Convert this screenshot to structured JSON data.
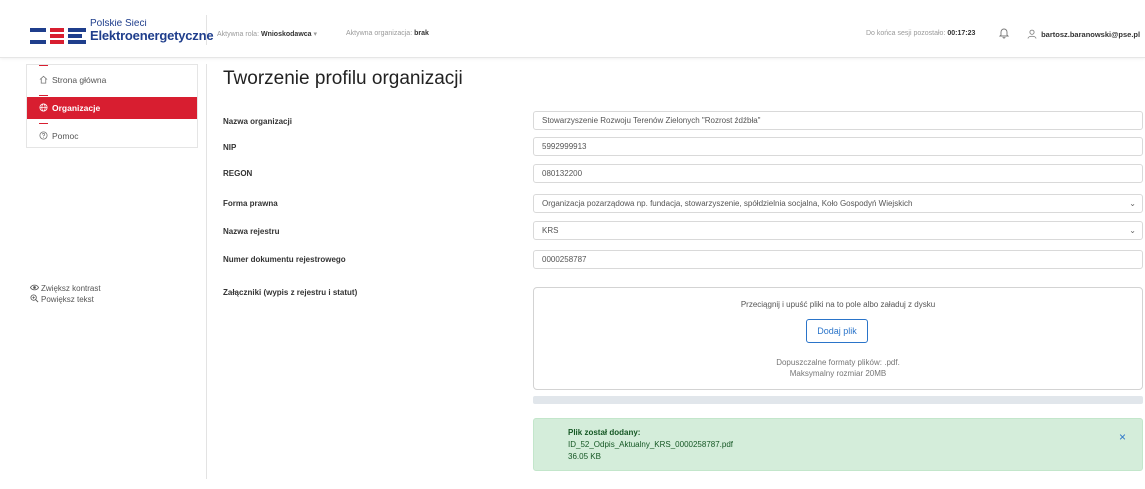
{
  "header": {
    "logo_top": "Polskie Sieci",
    "logo_main": "Elektroenergetyczne",
    "role_label": "Aktywna rola:",
    "role_value": "Wnioskodawca",
    "role_chevron": "▾",
    "org_label": "Aktywna organizacja:",
    "org_value": "brak",
    "session_label": "Do końca sesji pozostało:",
    "session_value": "00:17:23",
    "user": "bartosz.baranowski@pse.pl"
  },
  "sidebar": {
    "items": [
      {
        "label": "Strona główna",
        "icon": "home-icon"
      },
      {
        "label": "Organizacje",
        "icon": "globe-icon"
      },
      {
        "label": "Pomoc",
        "icon": "help-icon"
      }
    ],
    "accessibility": {
      "contrast": "Zwiększ kontrast",
      "text": "Powiększ tekst"
    }
  },
  "main": {
    "title": "Tworzenie profilu organizacji",
    "fields": [
      {
        "label": "Nazwa organizacji",
        "value": "Stowarzyszenie Rozwoju Terenów Zielonych \"Rozrost źdźbła\""
      },
      {
        "label": "NIP",
        "value": "5992999913"
      },
      {
        "label": "REGON",
        "value": "080132200"
      },
      {
        "label": "Forma prawna",
        "value": "Organizacja pozarządowa np. fundacja, stowarzyszenie, spółdzielnia socjalna, Koło Gospodyń Wiejskich"
      },
      {
        "label": "Nazwa rejestru",
        "value": "KRS"
      },
      {
        "label": "Numer dokumentu rejestrowego",
        "value": "0000258787"
      }
    ],
    "attachments": {
      "label": "Załączniki (wypis z rejestru i statut)",
      "drop_text": "Przeciągnij i upuść pliki na to pole albo załaduj z dysku",
      "button": "Dodaj plik",
      "formats": "Dopuszczalne formaty plików: .pdf.",
      "max_size": "Maksymalny rozmiar 20MB"
    },
    "alert": {
      "title": "Plik został dodany:",
      "file": "ID_52_Odpis_Aktualny_KRS_0000258787.pdf",
      "size": "36.05 KB",
      "close": "×"
    }
  },
  "colors": {
    "brand_red": "#d81e30",
    "brand_blue": "#1f3e8c",
    "link_blue": "#2a74c9",
    "success_bg": "#d4edda"
  }
}
